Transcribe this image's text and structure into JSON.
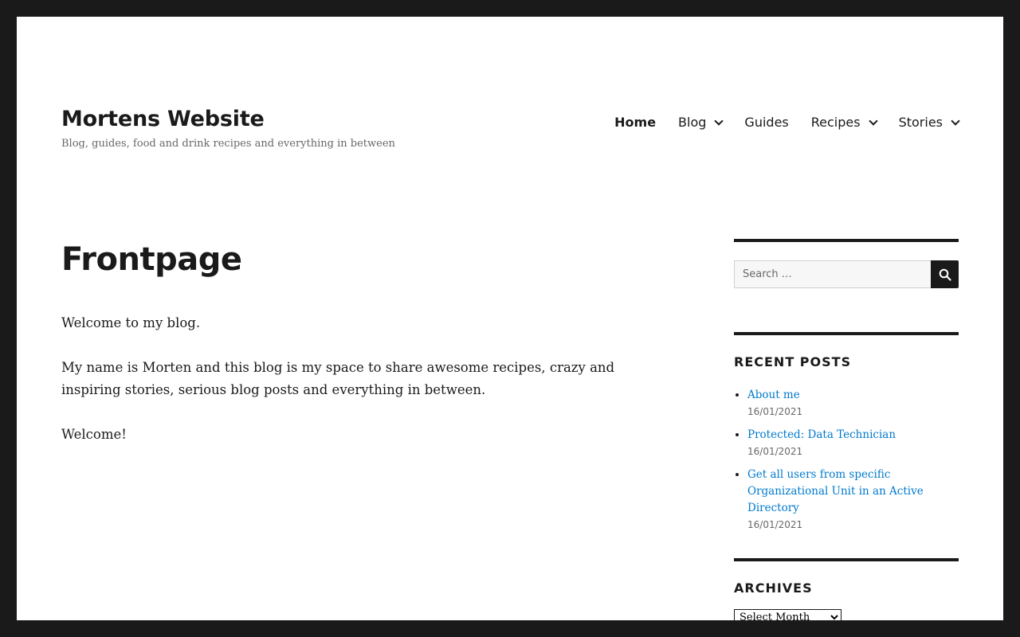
{
  "site": {
    "title": "Mortens Website",
    "description": "Blog, guides, food and drink recipes and everything in between"
  },
  "nav": {
    "items": [
      {
        "label": "Home",
        "active": true,
        "has_submenu": false
      },
      {
        "label": "Blog",
        "active": false,
        "has_submenu": true
      },
      {
        "label": "Guides",
        "active": false,
        "has_submenu": false
      },
      {
        "label": "Recipes",
        "active": false,
        "has_submenu": true
      },
      {
        "label": "Stories",
        "active": false,
        "has_submenu": true
      }
    ]
  },
  "page": {
    "title": "Frontpage",
    "paragraphs": [
      "Welcome to my blog.",
      "My name is Morten and this blog is my space to share awesome recipes, crazy and inspiring stories, serious blog posts and everything in between.",
      "Welcome!"
    ]
  },
  "search": {
    "placeholder": "Search …",
    "icon": "search-icon"
  },
  "recent_posts": {
    "title": "Recent Posts",
    "items": [
      {
        "title": "About me",
        "date": "16/01/2021"
      },
      {
        "title": "Protected: Data Technician",
        "date": "16/01/2021"
      },
      {
        "title": "Get all users from specific Organizational Unit in an Active Directory",
        "date": "16/01/2021"
      }
    ]
  },
  "archives": {
    "title": "Archives",
    "select_value": "Select Month"
  },
  "colors": {
    "frame": "#1a1a1a",
    "text": "#1a1a1a",
    "muted": "#686868",
    "link": "#007acc"
  }
}
